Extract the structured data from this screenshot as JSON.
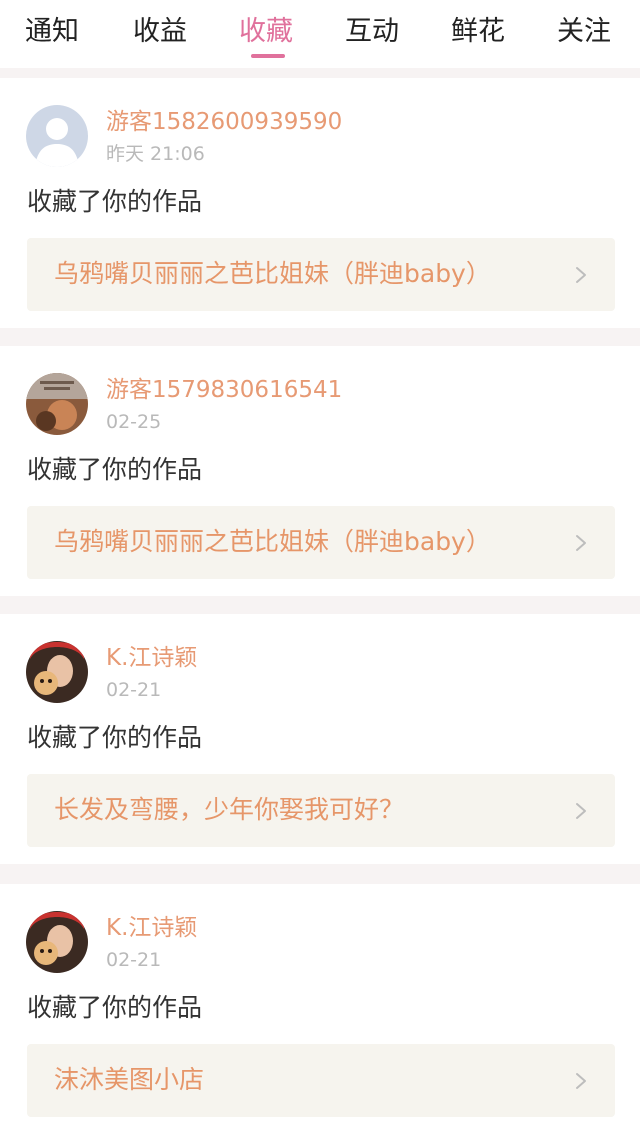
{
  "tabs": [
    {
      "label": "通知",
      "active": false
    },
    {
      "label": "收益",
      "active": false
    },
    {
      "label": "收藏",
      "active": true
    },
    {
      "label": "互动",
      "active": false
    },
    {
      "label": "鲜花",
      "active": false
    },
    {
      "label": "关注",
      "active": false
    }
  ],
  "colors": {
    "accent": "#e0719c",
    "username": "#e79a74",
    "work_title": "#e69669",
    "timestamp": "#b9b9b9",
    "link_bg": "#f6f4ee",
    "separator": "#f7f3f3"
  },
  "items": [
    {
      "user": "游客1582600939590",
      "time": "昨天 21:06",
      "action": "收藏了你的作品",
      "work": "乌鸦嘴贝丽丽之芭比姐妹（胖迪baby）",
      "avatar": "default-avatar-icon"
    },
    {
      "user": "游客1579830616541",
      "time": "02-25",
      "action": "收藏了你的作品",
      "work": "乌鸦嘴贝丽丽之芭比姐妹（胖迪baby）",
      "avatar": "photo-avatar"
    },
    {
      "user": "K.江诗颖",
      "time": "02-21",
      "action": "收藏了你的作品",
      "work": "长发及弯腰，少年你娶我可好？",
      "avatar": "photo-avatar"
    },
    {
      "user": "K.江诗颖",
      "time": "02-21",
      "action": "收藏了你的作品",
      "work": "沫沐美图小店",
      "avatar": "photo-avatar"
    }
  ]
}
